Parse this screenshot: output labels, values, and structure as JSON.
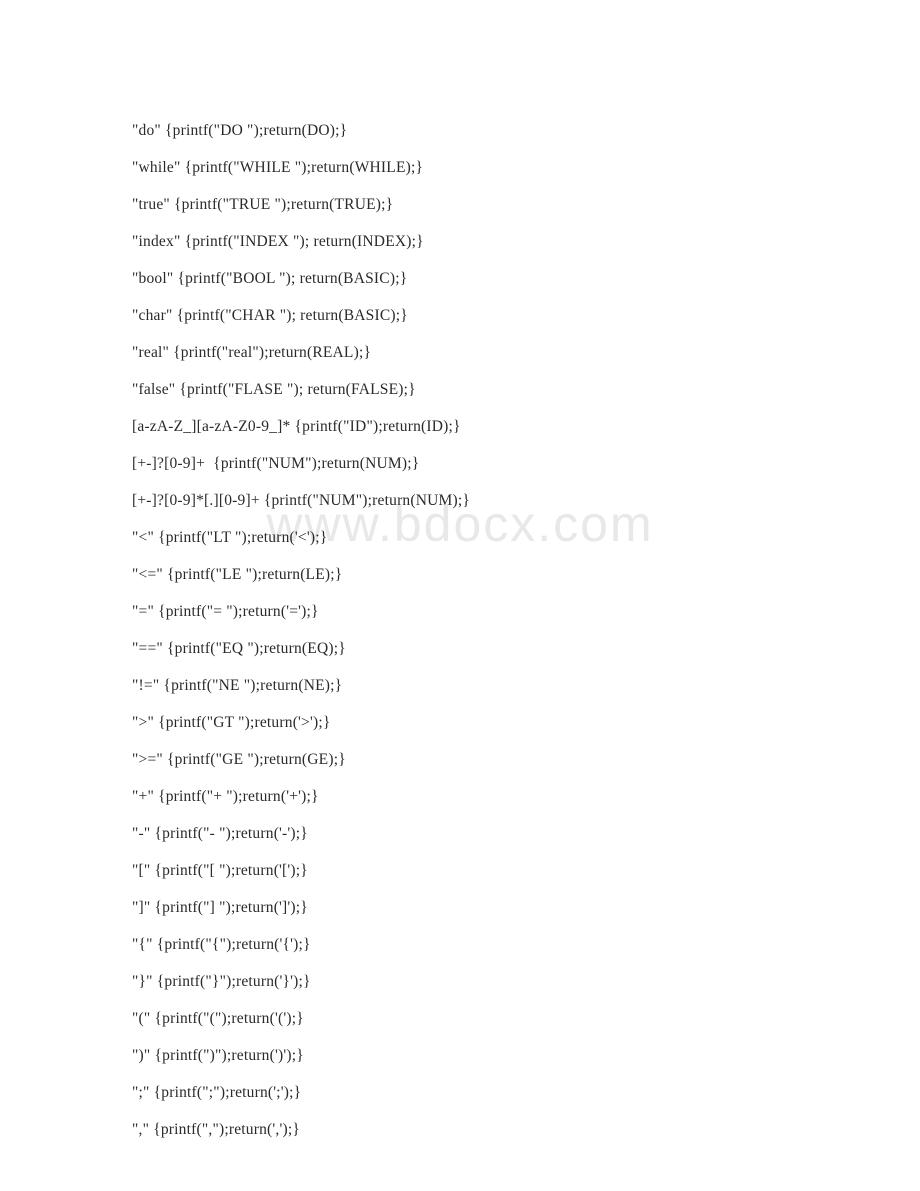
{
  "watermark": "www.bdocx.com",
  "lines": [
    "\"do\" {printf(\"DO \");return(DO);}",
    "\"while\" {printf(\"WHILE \");return(WHILE);}",
    "\"true\" {printf(\"TRUE \");return(TRUE);}",
    "\"index\" {printf(\"INDEX \"); return(INDEX);}",
    "\"bool\" {printf(\"BOOL \"); return(BASIC);}",
    "\"char\" {printf(\"CHAR \"); return(BASIC);}",
    "\"real\" {printf(\"real\");return(REAL);}",
    "\"false\" {printf(\"FLASE \"); return(FALSE);}",
    "[a-zA-Z_][a-zA-Z0-9_]* {printf(\"ID\");return(ID);}",
    "[+-]?[0-9]+  {printf(\"NUM\");return(NUM);}",
    "[+-]?[0-9]*[.][0-9]+ {printf(\"NUM\");return(NUM);}",
    "\"<\" {printf(\"LT \");return('<');}",
    "\"<=\" {printf(\"LE \");return(LE);}",
    "\"=\" {printf(\"= \");return('=');}",
    "\"==\" {printf(\"EQ \");return(EQ);}",
    "\"!=\" {printf(\"NE \");return(NE);}",
    "\">\" {printf(\"GT \");return('>');}",
    "\">=\" {printf(\"GE \");return(GE);}",
    "\"+\" {printf(\"+ \");return('+');}",
    "\"-\" {printf(\"- \");return('-');}",
    "\"[\" {printf(\"[ \");return('[');}",
    "\"]\" {printf(\"] \");return(']');}",
    "\"{\" {printf(\"{\");return('{');}",
    "\"}\" {printf(\"}\");return('}');}",
    "\"(\" {printf(\"(\");return('(');}",
    "\")\" {printf(\")\");return(')');}",
    "\";\" {printf(\";\");return(';');}",
    "\",\" {printf(\",\");return(',');}"
  ]
}
